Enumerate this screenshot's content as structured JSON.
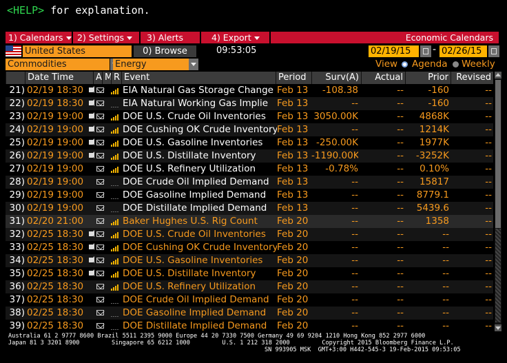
{
  "help": {
    "key": "<HELP>",
    "text": " for explanation."
  },
  "menu": {
    "calendars": "1) Calendars",
    "settings": "2) Settings",
    "alerts": "3) Alerts",
    "export": "4) Export",
    "title": "Economic Calendars"
  },
  "toolbar": {
    "country": "United States",
    "browse": "Browse",
    "browse_prefix": "0)",
    "time": "09:53:05",
    "date_from": "02/19/15",
    "date_to": "02/26/15",
    "filter1": "Commodities",
    "filter2": "Energy",
    "view_label": "View",
    "view_agenda": "Agenda",
    "view_weekly": "Weekly"
  },
  "columns": {
    "datetime": "Date Time",
    "a": "A",
    "m": "M",
    "r": "R",
    "event": "Event",
    "period": "Period",
    "surv": "Surv(A)",
    "actual": "Actual",
    "prior": "Prior",
    "revised": "Revised"
  },
  "rows": [
    {
      "n": "21)",
      "dt": "02/19 18:30",
      "speaker": true,
      "rel": 4,
      "event": "EIA Natural Gas Storage Change",
      "period": "Feb 13",
      "surv": "-108.38",
      "actual": "--",
      "prior": "-160",
      "revised": "--",
      "past": true
    },
    {
      "n": "22)",
      "dt": "02/19 18:30",
      "speaker": true,
      "rel": 0,
      "event": "EIA Natural Working Gas Implie",
      "period": "Feb 13",
      "surv": "--",
      "actual": "--",
      "prior": "-160",
      "revised": "--",
      "past": true
    },
    {
      "n": "23)",
      "dt": "02/19 19:00",
      "speaker": true,
      "rel": 4,
      "event": "DOE U.S. Crude Oil Inventories",
      "period": "Feb 13",
      "surv": "3050.00K",
      "actual": "--",
      "prior": "4868K",
      "revised": "--",
      "past": true
    },
    {
      "n": "24)",
      "dt": "02/19 19:00",
      "speaker": true,
      "rel": 4,
      "event": "DOE Cushing OK Crude Inventory",
      "period": "Feb 13",
      "surv": "--",
      "actual": "--",
      "prior": "1214K",
      "revised": "--",
      "past": true
    },
    {
      "n": "25)",
      "dt": "02/19 19:00",
      "speaker": true,
      "rel": 4,
      "event": "DOE U.S. Gasoline Inventories",
      "period": "Feb 13",
      "surv": "-250.00K",
      "actual": "--",
      "prior": "1977K",
      "revised": "--",
      "past": true
    },
    {
      "n": "26)",
      "dt": "02/19 19:00",
      "speaker": true,
      "rel": 4,
      "event": "DOE U.S. Distillate Inventory",
      "period": "Feb 13",
      "surv": "-1190.00K",
      "actual": "--",
      "prior": "-3252K",
      "revised": "--",
      "past": true
    },
    {
      "n": "27)",
      "dt": "02/19 19:00",
      "speaker": false,
      "rel": 4,
      "event": "DOE U.S. Refinery Utilization",
      "period": "Feb 13",
      "surv": "-0.78%",
      "actual": "--",
      "prior": "0.10%",
      "revised": "--",
      "past": true
    },
    {
      "n": "28)",
      "dt": "02/19 19:00",
      "speaker": false,
      "rel": 0,
      "event": "DOE Crude Oil Implied Demand",
      "period": "Feb 13",
      "surv": "--",
      "actual": "--",
      "prior": "15817",
      "revised": "--",
      "past": true
    },
    {
      "n": "29)",
      "dt": "02/19 19:00",
      "speaker": false,
      "rel": 0,
      "event": "DOE Gasoline Implied Demand",
      "period": "Feb 13",
      "surv": "--",
      "actual": "--",
      "prior": "8779.1",
      "revised": "--",
      "past": true
    },
    {
      "n": "30)",
      "dt": "02/19 19:00",
      "speaker": false,
      "rel": 0,
      "event": "DOE Distillate Implied Demand",
      "period": "Feb 13",
      "surv": "--",
      "actual": "--",
      "prior": "5439.6",
      "revised": "--",
      "past": true
    },
    {
      "n": "31)",
      "dt": "02/20 21:00",
      "speaker": false,
      "rel": 4,
      "event": "Baker Hughes U.S. Rig Count",
      "period": "Feb 20",
      "surv": "--",
      "actual": "--",
      "prior": "1358",
      "revised": "--",
      "past": false,
      "selected": true
    },
    {
      "n": "32)",
      "dt": "02/25 18:30",
      "speaker": true,
      "rel": 4,
      "event": "DOE U.S. Crude Oil Inventories",
      "period": "Feb 20",
      "surv": "--",
      "actual": "--",
      "prior": "--",
      "revised": "--",
      "past": false
    },
    {
      "n": "33)",
      "dt": "02/25 18:30",
      "speaker": true,
      "rel": 4,
      "event": "DOE Cushing OK Crude Inventory",
      "period": "Feb 20",
      "surv": "--",
      "actual": "--",
      "prior": "--",
      "revised": "--",
      "past": false
    },
    {
      "n": "34)",
      "dt": "02/25 18:30",
      "speaker": true,
      "rel": 4,
      "event": "DOE U.S. Gasoline Inventories",
      "period": "Feb 20",
      "surv": "--",
      "actual": "--",
      "prior": "--",
      "revised": "--",
      "past": false
    },
    {
      "n": "35)",
      "dt": "02/25 18:30",
      "speaker": true,
      "rel": 4,
      "event": "DOE U.S. Distillate Inventory",
      "period": "Feb 20",
      "surv": "--",
      "actual": "--",
      "prior": "--",
      "revised": "--",
      "past": false
    },
    {
      "n": "36)",
      "dt": "02/25 18:30",
      "speaker": false,
      "rel": 4,
      "event": "DOE U.S. Refinery Utilization",
      "period": "Feb 20",
      "surv": "--",
      "actual": "--",
      "prior": "--",
      "revised": "--",
      "past": false
    },
    {
      "n": "37)",
      "dt": "02/25 18:30",
      "speaker": false,
      "rel": 0,
      "event": "DOE Crude Oil Implied Demand",
      "period": "Feb 20",
      "surv": "--",
      "actual": "--",
      "prior": "--",
      "revised": "--",
      "past": false
    },
    {
      "n": "38)",
      "dt": "02/25 18:30",
      "speaker": false,
      "rel": 0,
      "event": "DOE Gasoline Implied Demand",
      "period": "Feb 20",
      "surv": "--",
      "actual": "--",
      "prior": "--",
      "revised": "--",
      "past": false
    },
    {
      "n": "39)",
      "dt": "02/25 18:30",
      "speaker": false,
      "rel": 0,
      "event": "DOE Distillate Implied Demand",
      "period": "Feb 20",
      "surv": "--",
      "actual": "--",
      "prior": "--",
      "revised": "--",
      "past": false
    }
  ],
  "footer": {
    "line1": "Australia 61 2 9777 8600 Brazil 5511 2395 9000 Europe 44 20 7330 7500 Germany 49 69 9204 1210 Hong Kong 852 2977 6000",
    "line2": "Japan 81 3 3201 8900         Singapore 65 6212 1000         U.S. 1 212 318 2000         Copyright 2015 Bloomberg Finance L.P.",
    "line3": "SN 993905 MSK  GMT+3:00 H442-545-3 19-Feb-2015 09:53:05"
  },
  "colors": {
    "accent_orange": "#f79a1e",
    "menu_red": "#c8102e",
    "help_green": "#2fd84f"
  }
}
